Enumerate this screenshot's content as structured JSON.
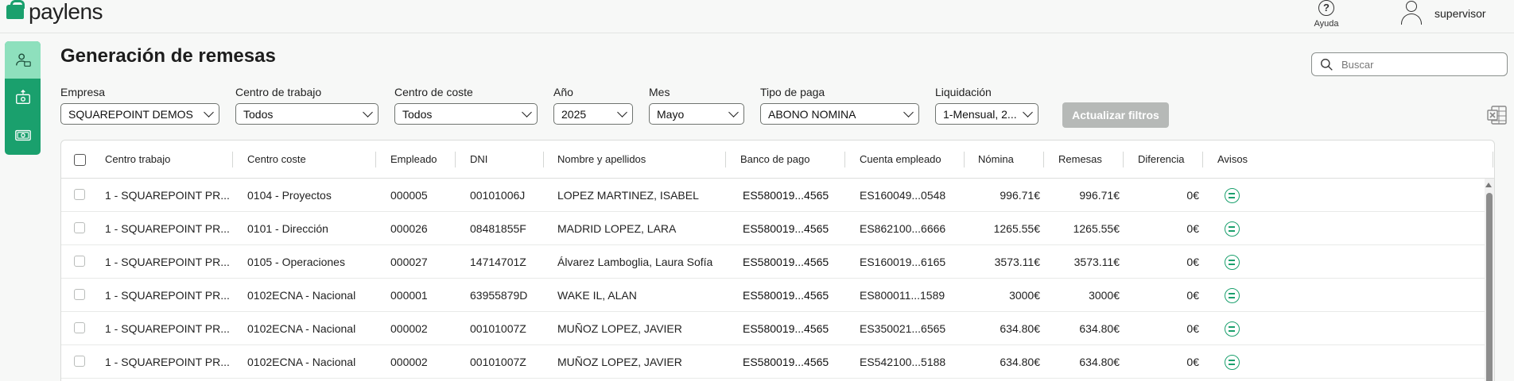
{
  "app": {
    "brand": "paylens",
    "accent_color": "#1aa06d"
  },
  "header": {
    "help_label": "Ayuda",
    "user_name": "supervisor"
  },
  "sidebar": {
    "items": [
      {
        "icon": "employee-icon",
        "active": true
      },
      {
        "icon": "money-upload-icon",
        "active": false
      },
      {
        "icon": "money-icon",
        "active": false
      }
    ]
  },
  "page": {
    "title": "Generación de remesas"
  },
  "search": {
    "placeholder": "Buscar"
  },
  "filters": {
    "empresa": {
      "label": "Empresa",
      "value": "SQUAREPOINT DEMOS"
    },
    "centro_trabajo": {
      "label": "Centro de trabajo",
      "value": "Todos"
    },
    "centro_coste": {
      "label": "Centro de coste",
      "value": "Todos"
    },
    "anio": {
      "label": "Año",
      "value": "2025"
    },
    "mes": {
      "label": "Mes",
      "value": "Mayo"
    },
    "tipo_paga": {
      "label": "Tipo de paga",
      "value": "ABONO NOMINA"
    },
    "liquidacion": {
      "label": "Liquidación",
      "value": "1-Mensual, 2..."
    },
    "update_button": "Actualizar filtros",
    "export_icon": "excel-icon"
  },
  "table": {
    "columns": [
      "Centro trabajo",
      "Centro coste",
      "Empleado",
      "DNI",
      "Nombre y apellidos",
      "Banco de pago",
      "Cuenta empleado",
      "Nómina",
      "Remesas",
      "Diferencia",
      "Avisos"
    ],
    "rows": [
      {
        "centro_trabajo": "1 - SQUAREPOINT PR...",
        "centro_coste": "0104 - Proyectos",
        "empleado": "000005",
        "dni": "00101006J",
        "nombre": "LOPEZ MARTINEZ, ISABEL",
        "banco": "ES580019...4565",
        "cuenta": "ES160049...0548",
        "nomina": "996.71€",
        "remesas": "996.71€",
        "diferencia": "0€"
      },
      {
        "centro_trabajo": "1 - SQUAREPOINT PR...",
        "centro_coste": "0101 - Dirección",
        "empleado": "000026",
        "dni": "08481855F",
        "nombre": "MADRID LOPEZ, LARA",
        "banco": "ES580019...4565",
        "cuenta": "ES862100...6666",
        "nomina": "1265.55€",
        "remesas": "1265.55€",
        "diferencia": "0€"
      },
      {
        "centro_trabajo": "1 - SQUAREPOINT PR...",
        "centro_coste": "0105 - Operaciones",
        "empleado": "000027",
        "dni": "14714701Z",
        "nombre": "Álvarez Lamboglia, Laura Sofía",
        "banco": "ES580019...4565",
        "cuenta": "ES160019...6165",
        "nomina": "3573.11€",
        "remesas": "3573.11€",
        "diferencia": "0€"
      },
      {
        "centro_trabajo": "1 - SQUAREPOINT PR...",
        "centro_coste": "0102ECNA - Nacional",
        "empleado": "000001",
        "dni": "63955879D",
        "nombre": "WAKE IL, ALAN",
        "banco": "ES580019...4565",
        "cuenta": "ES800011...1589",
        "nomina": "3000€",
        "remesas": "3000€",
        "diferencia": "0€"
      },
      {
        "centro_trabajo": "1 - SQUAREPOINT PR...",
        "centro_coste": "0102ECNA - Nacional",
        "empleado": "000002",
        "dni": "00101007Z",
        "nombre": "MUÑOZ LOPEZ, JAVIER",
        "banco": "ES580019...4565",
        "cuenta": "ES350021...6565",
        "nomina": "634.80€",
        "remesas": "634.80€",
        "diferencia": "0€"
      },
      {
        "centro_trabajo": "1 - SQUAREPOINT PR...",
        "centro_coste": "0102ECNA - Nacional",
        "empleado": "000002",
        "dni": "00101007Z",
        "nombre": "MUÑOZ LOPEZ, JAVIER",
        "banco": "ES580019...4565",
        "cuenta": "ES542100...5188",
        "nomina": "634.80€",
        "remesas": "634.80€",
        "diferencia": "0€"
      }
    ]
  }
}
